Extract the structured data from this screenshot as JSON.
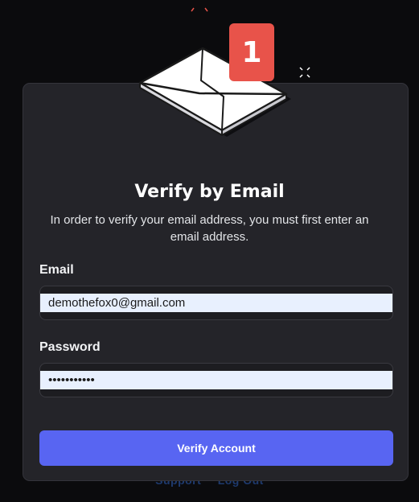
{
  "notification": {
    "count": "1"
  },
  "title": "Verify by Email",
  "subtitle": "In order to verify your email address, you must first enter an email address.",
  "fields": {
    "email": {
      "label": "Email",
      "value": "demothefox0@gmail.com"
    },
    "password": {
      "label": "Password",
      "value": "demothefox0"
    }
  },
  "verify_button": "Verify Account",
  "footer": {
    "links": [
      "Support",
      "Log Out"
    ]
  },
  "colors": {
    "accent": "#5865f2",
    "badge": "#e8534a",
    "modal": "#242429",
    "background": "#0b0b0d"
  }
}
